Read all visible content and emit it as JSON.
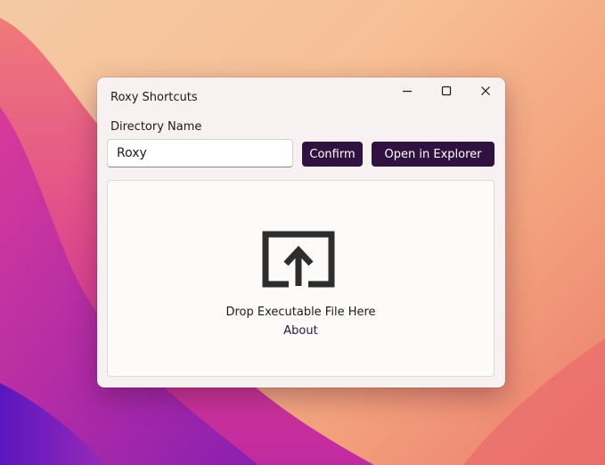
{
  "window": {
    "title": "Roxy Shortcuts",
    "controls": {
      "minimize_icon": "minimize-icon",
      "maximize_icon": "maximize-icon",
      "close_icon": "close-icon"
    }
  },
  "form": {
    "directory_label": "Directory Name",
    "directory_value": "Roxy",
    "confirm_label": "Confirm",
    "explorer_label": "Open in Explorer"
  },
  "drop_zone": {
    "icon": "upload-icon",
    "text": "Drop Executable File Here",
    "about_label": "About"
  },
  "colors": {
    "accent": "#2f1240",
    "window_bg": "#f8f1f1",
    "panel_bg": "#fdfafa"
  }
}
